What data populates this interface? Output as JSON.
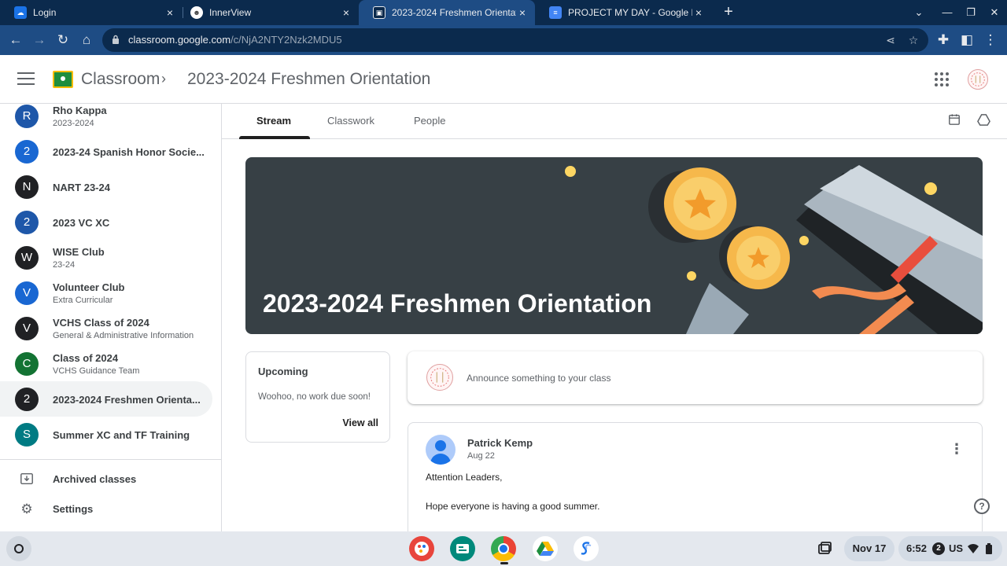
{
  "browser": {
    "tabs": [
      {
        "title": "Login",
        "close": "×"
      },
      {
        "title": "InnerView",
        "close": "×"
      },
      {
        "title": "2023-2024 Freshmen Orientation",
        "close": "×"
      },
      {
        "title": "PROJECT MY DAY - Google Docs",
        "close": "×"
      }
    ],
    "new_tab": "+",
    "url_host": "classroom.google.com",
    "url_path": "/c/NjA2NTY2Nzk2MDU5"
  },
  "header": {
    "app_name": "Classroom",
    "class_title": "2023-2024 Freshmen Orientation"
  },
  "sidebar": {
    "classes": [
      {
        "initial": "R",
        "name": "Rho Kappa",
        "sub": "2023-2024",
        "color": "#1e57a9"
      },
      {
        "initial": "2",
        "name": "2023-24 Spanish Honor Socie...",
        "sub": "",
        "color": "#1967d2"
      },
      {
        "initial": "N",
        "name": "NART 23-24",
        "sub": "",
        "color": "#202124"
      },
      {
        "initial": "2",
        "name": "2023 VC XC",
        "sub": "",
        "color": "#1e57a9"
      },
      {
        "initial": "W",
        "name": "WISE Club",
        "sub": "23-24",
        "color": "#202124"
      },
      {
        "initial": "V",
        "name": "Volunteer Club",
        "sub": "Extra Curricular",
        "color": "#1967d2"
      },
      {
        "initial": "V",
        "name": "VCHS Class of 2024",
        "sub": "General & Administrative Information",
        "color": "#202124"
      },
      {
        "initial": "C",
        "name": "Class of 2024",
        "sub": "VCHS Guidance Team",
        "color": "#137333"
      },
      {
        "initial": "2",
        "name": "2023-2024 Freshmen Orienta...",
        "sub": "",
        "color": "#202124"
      },
      {
        "initial": "S",
        "name": "Summer XC and TF Training",
        "sub": "",
        "color": "#007b83"
      }
    ],
    "archived": "Archived classes",
    "settings": "Settings"
  },
  "main": {
    "tabs": {
      "stream": "Stream",
      "classwork": "Classwork",
      "people": "People"
    },
    "banner_title": "2023-2024 Freshmen Orientation",
    "upcoming": {
      "heading": "Upcoming",
      "text": "Woohoo, no work due soon!",
      "link": "View all"
    },
    "announce_placeholder": "Announce something to your class",
    "post": {
      "author": "Patrick Kemp",
      "date": "Aug 22",
      "line1": "Attention Leaders,",
      "line2": "Hope everyone is having a good summer."
    },
    "help": "?"
  },
  "shelf": {
    "date": "Nov 17",
    "time": "6:52",
    "notif_count": "2",
    "locale": "US"
  },
  "colors": {
    "tabstrip": "#0b2a4d",
    "toolbar": "#1e4c84",
    "banner": "#374045",
    "classroom_green": "#1e8e3e"
  }
}
